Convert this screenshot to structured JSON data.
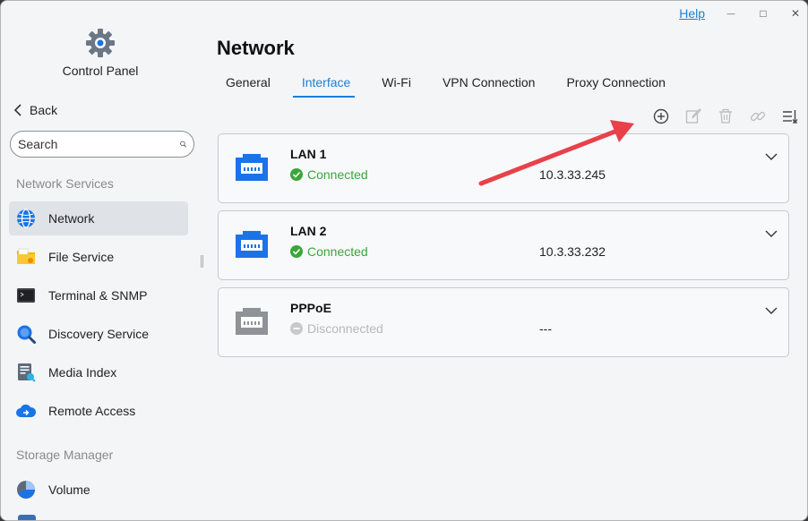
{
  "sidebar": {
    "app_title": "Control Panel",
    "back_label": "Back",
    "search_placeholder": "Search",
    "sections": [
      {
        "title": "Network Services",
        "items": [
          {
            "label": "Network",
            "icon": "globe-icon",
            "active": true
          },
          {
            "label": "File Service",
            "icon": "folder-icon"
          },
          {
            "label": "Terminal & SNMP",
            "icon": "terminal-icon"
          },
          {
            "label": "Discovery Service",
            "icon": "magnifier-icon"
          },
          {
            "label": "Media Index",
            "icon": "media-index-icon"
          }
        ]
      }
    ],
    "extra_items": [
      {
        "label": "Remote Access",
        "icon": "cloud-icon"
      }
    ],
    "section2": {
      "title": "Storage Manager",
      "items": [
        {
          "label": "Volume",
          "icon": "volume-icon"
        }
      ]
    }
  },
  "titlebar": {
    "help_label": "Help",
    "minimize": "—",
    "maximize": "□",
    "close": "✕"
  },
  "main": {
    "title": "Network",
    "tabs": [
      {
        "label": "General"
      },
      {
        "label": "Interface",
        "active": true
      },
      {
        "label": "Wi-Fi"
      },
      {
        "label": "VPN Connection"
      },
      {
        "label": "Proxy Connection"
      }
    ],
    "toolbar": [
      "add-icon",
      "edit-icon",
      "delete-icon",
      "link-icon",
      "sort-icon"
    ],
    "interfaces": [
      {
        "name": "LAN 1",
        "status": "Connected",
        "ip": "10.3.33.245",
        "connected": true
      },
      {
        "name": "LAN 2",
        "status": "Connected",
        "ip": "10.3.33.232",
        "connected": true
      },
      {
        "name": "PPPoE",
        "status": "Disconnected",
        "ip": "---",
        "connected": false
      }
    ]
  },
  "colors": {
    "accent": "#1f7fd6",
    "connected": "#3aa63a",
    "disconnected": "#b8b8b8",
    "port_active": "#1a73e8",
    "port_inactive": "#8f9296",
    "annotation_arrow": "#e8414a"
  }
}
